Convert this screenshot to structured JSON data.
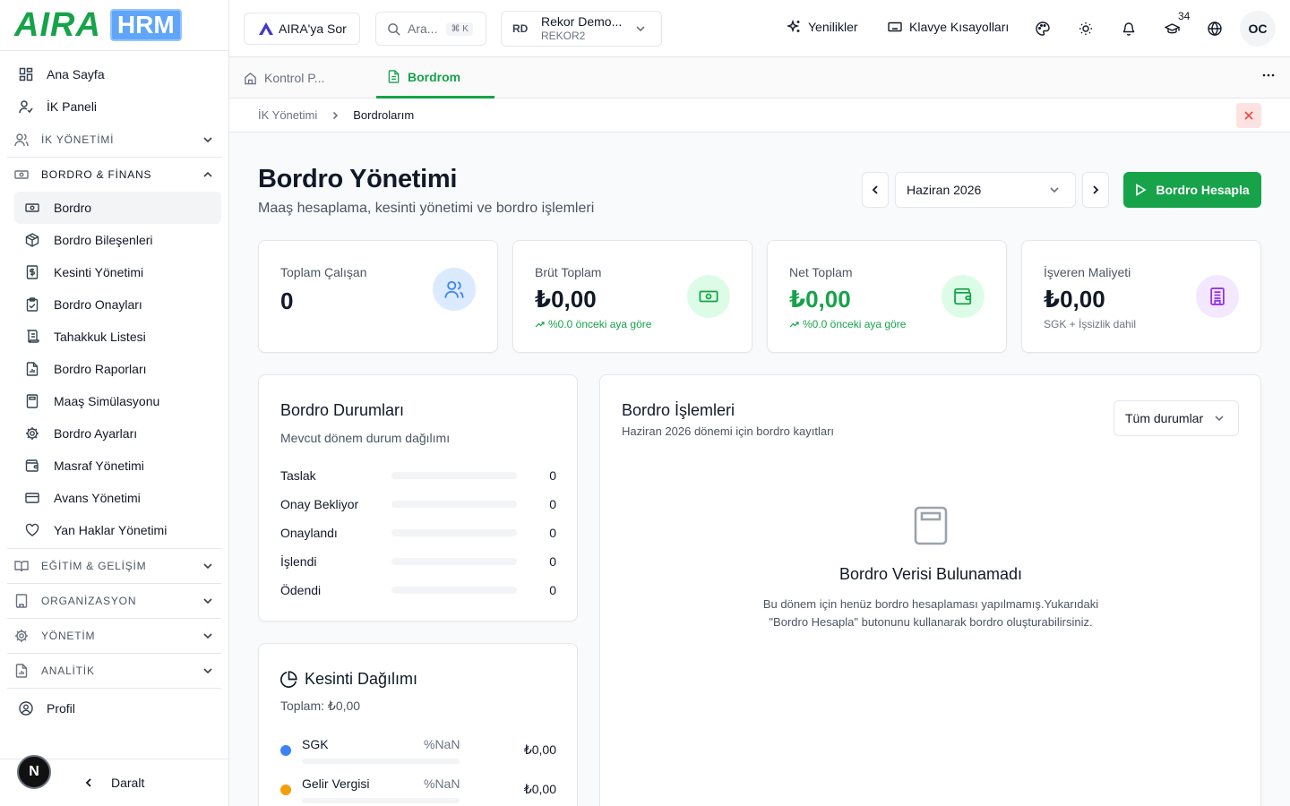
{
  "brand": {
    "name_part1": "AIRA",
    "name_part2": "HRM",
    "primary_color": "#16a34a"
  },
  "sidebar": {
    "top_items": [
      {
        "label": "Ana Sayfa",
        "icon": "dashboard-grid-icon"
      },
      {
        "label": "İK Paneli",
        "icon": "user-check-icon"
      }
    ],
    "sections": {
      "ik": {
        "label": "İK YÖNETİMİ",
        "icon": "users-icon"
      },
      "bordro": {
        "label": "BORDRO & FİNANS",
        "icon": "banknote-icon"
      },
      "egitim": {
        "label": "EĞİTİM & GELİŞİM",
        "icon": "book-open-icon"
      },
      "organizasyon": {
        "label": "ORGANİZASYON",
        "icon": "building-icon"
      },
      "yonetim": {
        "label": "YÖNETİM",
        "icon": "gear-icon"
      },
      "analitik": {
        "label": "ANALİTİK",
        "icon": "file-chart-icon"
      }
    },
    "bordro_items": [
      {
        "label": "Bordro",
        "icon": "banknote-icon",
        "active": true
      },
      {
        "label": "Bordro Bileşenleri",
        "icon": "package-icon"
      },
      {
        "label": "Kesinti Yönetimi",
        "icon": "receipt-dollar-icon"
      },
      {
        "label": "Bordro Onayları",
        "icon": "clipboard-check-icon"
      },
      {
        "label": "Tahakkuk Listesi",
        "icon": "scroll-icon"
      },
      {
        "label": "Bordro Raporları",
        "icon": "file-chart-icon"
      },
      {
        "label": "Maaş Simülasyonu",
        "icon": "calculator-icon"
      },
      {
        "label": "Bordro Ayarları",
        "icon": "gear-icon"
      },
      {
        "label": "Masraf Yönetimi",
        "icon": "wallet-icon"
      },
      {
        "label": "Avans Yönetimi",
        "icon": "credit-card-icon"
      },
      {
        "label": "Yan Haklar Yönetimi",
        "icon": "heart-icon"
      }
    ],
    "profile": {
      "label": "Profil",
      "icon": "user-circle-icon"
    },
    "collapse_label": "Daralt",
    "dev_badge": "N"
  },
  "topbar": {
    "aira_button": "AIRA'ya Sor",
    "search_placeholder": "Ara...",
    "search_shortcut": "⌘ K",
    "company": {
      "initials": "RD",
      "name": "Rekor Demo...",
      "code": "REKOR2"
    },
    "whats_new": "Yenilikler",
    "shortcuts": "Klavye Kısayolları",
    "training_count": "34",
    "avatar": "OC"
  },
  "tabs": [
    {
      "label": "Kontrol P...",
      "icon": "home-icon"
    },
    {
      "label": "Bordrom",
      "icon": "file-text-icon",
      "active": true
    }
  ],
  "breadcrumb": {
    "parent": "İK Yönetimi",
    "current": "Bordrolarım"
  },
  "page": {
    "title": "Bordro Yönetimi",
    "subtitle": "Maaş hesaplama, kesinti yönetimi ve bordro işlemleri",
    "period": "Haziran 2026",
    "calculate_button": "Bordro Hesapla"
  },
  "stats": [
    {
      "label": "Toplam Çalışan",
      "value": "0",
      "note": "",
      "icon": "users-icon",
      "color": "#3b82f6"
    },
    {
      "label": "Brüt Toplam",
      "value": "₺0,00",
      "note": "%0.0 önceki aya göre",
      "icon": "banknote-icon",
      "color": "#16a34a"
    },
    {
      "label": "Net Toplam",
      "value": "₺0,00",
      "note": "%0.0 önceki aya göre",
      "icon": "wallet-icon",
      "color": "#16a34a"
    },
    {
      "label": "İşveren Maliyeti",
      "value": "₺0,00",
      "note": "SGK + İşsizlik dahil",
      "icon": "building-icon",
      "color": "#9333ea"
    }
  ],
  "status_card": {
    "title": "Bordro Durumları",
    "subtitle": "Mevcut dönem durum dağılımı",
    "rows": [
      {
        "label": "Taslak",
        "count": "0"
      },
      {
        "label": "Onay Bekliyor",
        "count": "0"
      },
      {
        "label": "Onaylandı",
        "count": "0"
      },
      {
        "label": "İşlendi",
        "count": "0"
      },
      {
        "label": "Ödendi",
        "count": "0"
      }
    ]
  },
  "deduction_card": {
    "title": "Kesinti Dağılımı",
    "total": "Toplam: ₺0,00",
    "rows": [
      {
        "label": "SGK",
        "percent": "%NaN",
        "amount": "₺0,00",
        "color": "#3b82f6"
      },
      {
        "label": "Gelir Vergisi",
        "percent": "%NaN",
        "amount": "₺0,00",
        "color": "#f59e0b"
      }
    ]
  },
  "transactions_card": {
    "title": "Bordro İşlemleri",
    "subtitle": "Haziran 2026 dönemi için bordro kayıtları",
    "filter": "Tüm durumlar",
    "empty_title": "Bordro Verisi Bulunamadı",
    "empty_text": "Bu dönem için henüz bordro hesaplaması yapılmamış.Yukarıdaki \"Bordro Hesapla\" butonunu kullanarak bordro oluşturabilirsiniz."
  }
}
